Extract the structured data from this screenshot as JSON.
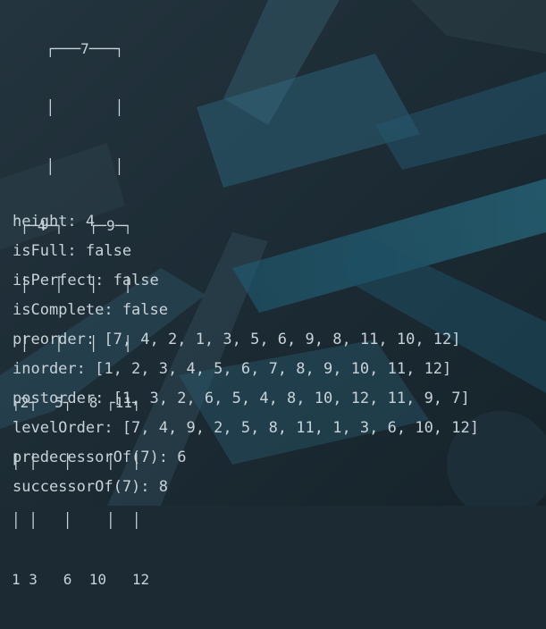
{
  "terminal": {
    "tree_lines": [
      "    ┌───7───┐",
      "    │       │",
      "    │       │",
      " ┌─4─┐   ┌─9─┐",
      " │   │   │   │",
      " │   │   │   │",
      "┌2┐  5┐  8 ┌11┐",
      "│ │   │    │  │",
      "│ │   │    │  │",
      "1 3   6  10   12"
    ],
    "output_lines": [
      "height: 4",
      "isFull: false",
      "isPerfect: false",
      "isComplete: false",
      "preorder: [7, 4, 2, 1, 3, 5, 6, 9, 8, 11, 10, 12]",
      "inorder: [1, 2, 3, 4, 5, 6, 7, 8, 9, 10, 11, 12]",
      "postorder: [1, 3, 2, 6, 5, 4, 8, 10, 12, 11, 9, 7]",
      "levelOrder: [7, 4, 9, 2, 5, 8, 11, 1, 3, 6, 10, 12]",
      "predecessorOf(7): 6",
      "successorOf(7): 8"
    ]
  },
  "colors": {
    "text": "#c8d2d8",
    "background": "#1b2a33"
  }
}
